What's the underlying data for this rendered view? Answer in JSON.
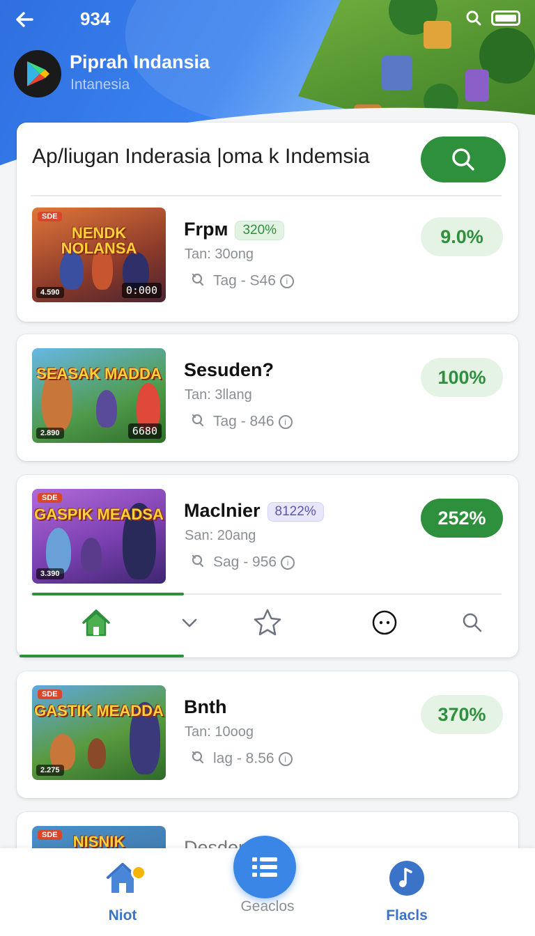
{
  "status": {
    "time": "934"
  },
  "header": {
    "title": "Piprah Indansia",
    "subtitle": "Intanesia"
  },
  "search": {
    "text": "Ap/liugan Inderasia |oma k Indemsia"
  },
  "items": [
    {
      "thumb_title": "NENDK NOLANSA",
      "thumb_tag": "SDE",
      "thumb_count": "4.590",
      "thumb_score": "0:000",
      "name": "Frpм",
      "badge": "320%",
      "sub": "Tan: 30ong",
      "tag": "Tag - S46",
      "pct": "9.0%",
      "pct_style": "light"
    },
    {
      "thumb_title": "SEASAK MADDA",
      "thumb_tag": "",
      "thumb_count": "2.890",
      "thumb_score": "6680",
      "name": "Sesuden?",
      "badge": "",
      "sub": "Tan: 3llang",
      "tag": "Tag - 846",
      "pct": "100%",
      "pct_style": "light"
    },
    {
      "thumb_title": "GASPIK MEADSA",
      "thumb_tag": "SDE",
      "thumb_count": "3.390",
      "thumb_score": "",
      "name": "Maclnier",
      "badge": "8122%",
      "sub": "San: 20ang",
      "tag": "Sag - 956",
      "pct": "252%",
      "pct_style": "dark"
    },
    {
      "thumb_title": "GASTIK MEADDA",
      "thumb_tag": "SDE",
      "thumb_count": "2.275",
      "thumb_score": "",
      "name": "Bnth",
      "badge": "",
      "sub": "Tan: 10oog",
      "tag": "lag - 8.56",
      "pct": "370%",
      "pct_style": "light"
    },
    {
      "thumb_title": "NISNIK",
      "thumb_tag": "SDE",
      "name": "Desder"
    }
  ],
  "tabs": [
    "home-icon",
    "chevron-down-icon",
    "star-icon",
    "more-icon",
    "search-icon"
  ],
  "nav": {
    "left_label": "Niot",
    "center_label": "Geaclos",
    "right_label": "Flacls"
  },
  "colors": {
    "primary_green": "#2e8f3c",
    "accent_blue": "#3a86e6",
    "badge_purple": "#5a56b0"
  }
}
